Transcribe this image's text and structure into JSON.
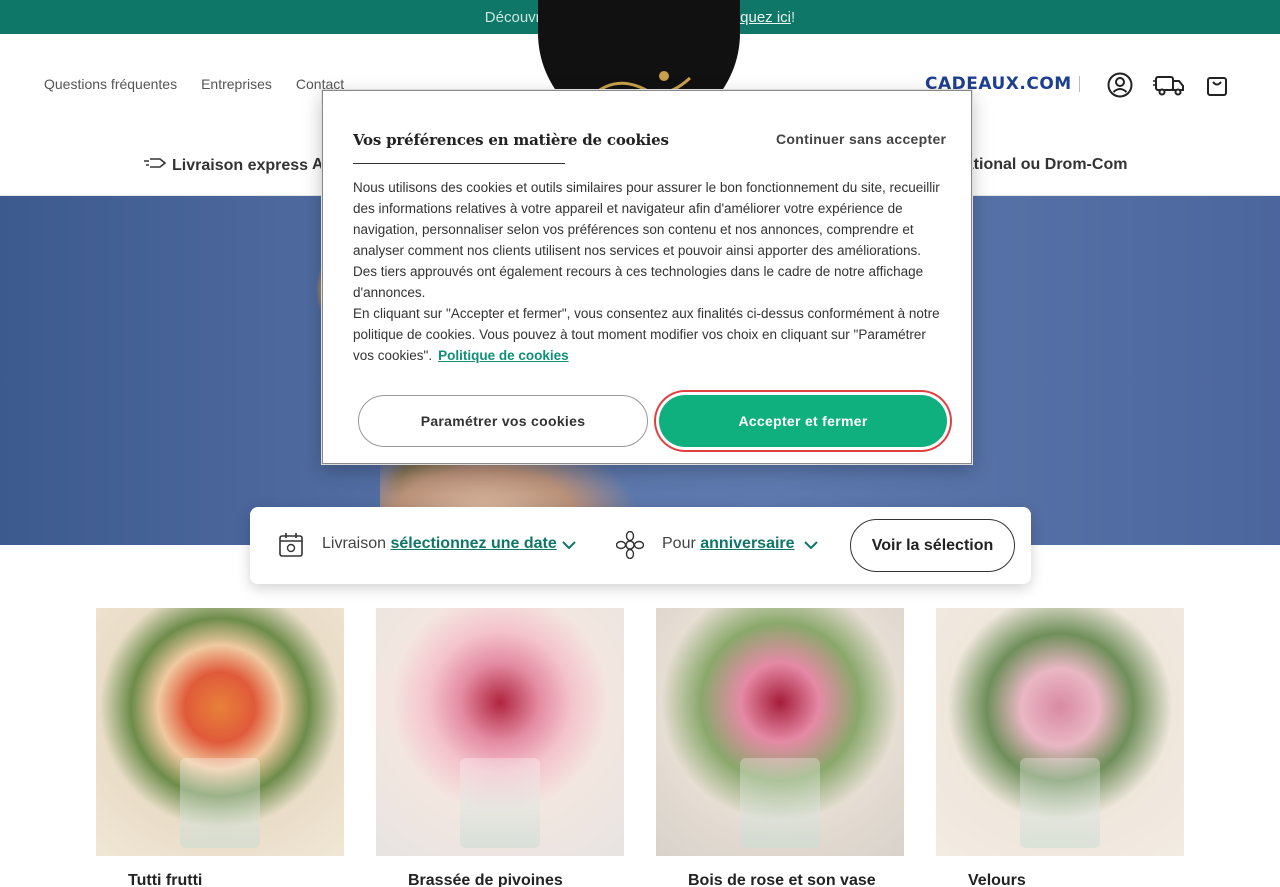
{
  "promo": {
    "text": "Découvrez nos bons plans de l'été :",
    "link": "cliquez ici",
    "suffix": "!"
  },
  "header": {
    "links": [
      "Questions fréquentes",
      "Entreprises",
      "Contact"
    ],
    "partner": "CADEAUX.COM",
    "icons": [
      "account-icon",
      "delivery-truck-icon",
      "cart-icon"
    ]
  },
  "nav": {
    "express": "Livraison express",
    "partial_left": "A",
    "partial_right": "national ou Drom-Com"
  },
  "search": {
    "delivery_label": "Livraison",
    "delivery_value": "sélectionnez une date",
    "occasion_label": "Pour",
    "occasion_value": "anniversaire",
    "submit": "Voir la sélection"
  },
  "products": [
    {
      "name": "Tutti frutti"
    },
    {
      "name": "Brassée de pivoines"
    },
    {
      "name": "Bois de rose et son vase"
    },
    {
      "name": "Velours"
    }
  ],
  "cookie_modal": {
    "title": "Vos préférences en matière de cookies",
    "skip": "Continuer sans accepter",
    "paragraph1": "Nous utilisons des cookies et outils similaires pour assurer le bon fonctionnement du site, recueillir des informations relatives à votre appareil et navigateur afin d'améliorer votre expérience de navigation, personnaliser selon vos préférences son contenu et nos annonces, comprendre et analyser comment nos clients utilisent nos services et pouvoir ainsi apporter des améliorations. Des tiers approuvés ont également recours à ces technologies dans le cadre de notre affichage d'annonces.",
    "paragraph2": "En cliquant sur \"Accepter et fermer\", vous consentez aux finalités ci-dessus conformément à notre politique de cookies. Vous pouvez à tout moment modifier vos choix en cliquant sur \"Paramétrer vos cookies\".",
    "policy_link": "Politique de cookies",
    "settings_button": "Paramétrer vos cookies",
    "accept_button": "Accepter et fermer"
  },
  "colors": {
    "brand_green": "#0f7768",
    "accept_green": "#10b07e",
    "partner_blue": "#1e3f8f"
  }
}
